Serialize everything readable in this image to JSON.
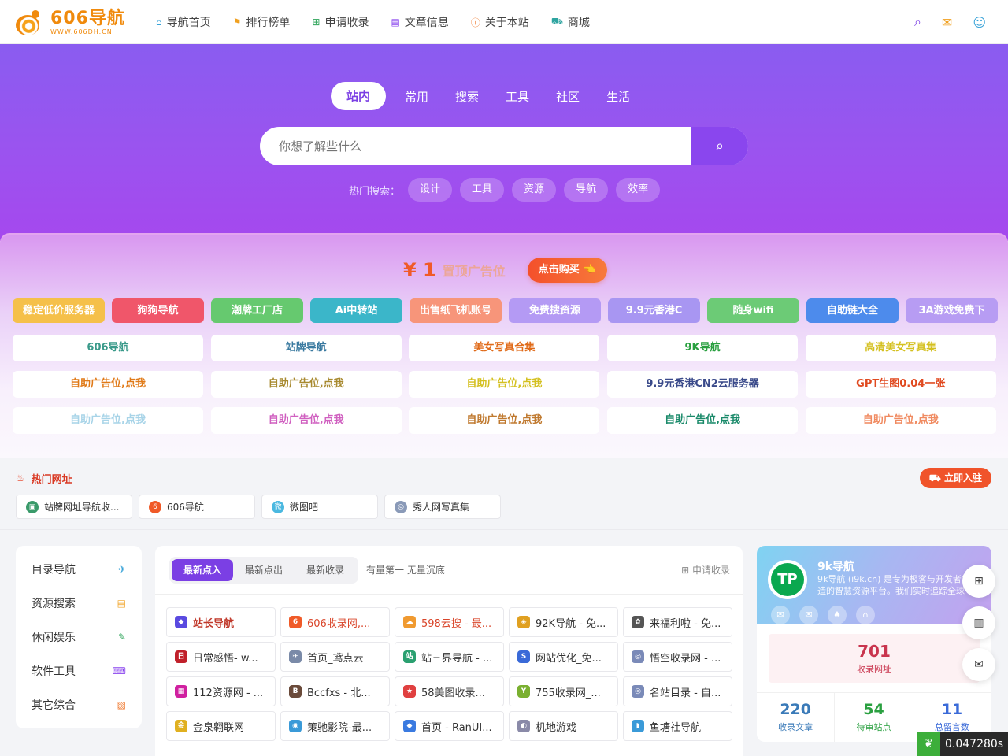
{
  "logo": {
    "main": "606导航",
    "sub": "WWW.606DH.CN"
  },
  "nav": [
    {
      "icon": "⌂",
      "label": "导航首页",
      "color": "#3aa3d8"
    },
    {
      "icon": "⚑",
      "label": "排行榜单",
      "color": "#f0a020"
    },
    {
      "icon": "⊞",
      "label": "申请收录",
      "color": "#2ea45a"
    },
    {
      "icon": "▤",
      "label": "文章信息",
      "color": "#8a46ee"
    },
    {
      "icon": "ⓘ",
      "label": "关于本站",
      "color": "#f07a30"
    },
    {
      "icon": "⛟",
      "label": "商城",
      "color": "#2ea4a0"
    }
  ],
  "nav_right": {
    "search": "⌕",
    "chat": "✉",
    "user": "☺"
  },
  "hero": {
    "tabs": [
      "站内",
      "常用",
      "搜索",
      "工具",
      "社区",
      "生活"
    ],
    "search_placeholder": "你想了解些什么",
    "search_icon": "⌕",
    "hot_label": "热门搜索：",
    "hot_tags": [
      "设计",
      "工具",
      "资源",
      "导航",
      "效率"
    ]
  },
  "ad": {
    "price": "¥ 1",
    "title": "置顶广告位",
    "buy": "点击购买 👈",
    "colored": [
      {
        "label": "稳定低价服务器",
        "bg": "#f5c04a"
      },
      {
        "label": "狗狗导航",
        "bg": "#f0566a"
      },
      {
        "label": "潮牌工厂店",
        "bg": "#66c96f"
      },
      {
        "label": "Ai中转站",
        "bg": "#3bb6c9"
      },
      {
        "label": "出售纸飞机账号",
        "bg": "#f7957a"
      },
      {
        "label": "免费搜资源",
        "bg": "#b49af4"
      },
      {
        "label": "9.9元香港C",
        "bg": "#a896f2"
      },
      {
        "label": "随身wifi",
        "bg": "#6ccb76"
      },
      {
        "label": "自助链大全",
        "bg": "#4d8bec"
      },
      {
        "label": "3A游戏免费下",
        "bg": "#b79cf3"
      }
    ],
    "white": [
      {
        "label": "606导航",
        "color": "#3a9a8a"
      },
      {
        "label": "站牌导航",
        "color": "#3a7aa0"
      },
      {
        "label": "美女写真合集",
        "color": "#e06a18"
      },
      {
        "label": "9K导航",
        "color": "#2aa040"
      },
      {
        "label": "高清美女写真集",
        "color": "#d4c020"
      },
      {
        "label": "自助广告位,点我",
        "color": "#e07a18"
      },
      {
        "label": "自助广告位,点我",
        "color": "#a88a30"
      },
      {
        "label": "自助广告位,点我",
        "color": "#d4c020"
      },
      {
        "label": "9.9元香港CN2云服务器",
        "color": "#3a4a8a"
      },
      {
        "label": "GPT生图0.04一张",
        "color": "#e04a20"
      },
      {
        "label": "自助广告位,点我",
        "color": "#a8d4e8"
      },
      {
        "label": "自助广告位,点我",
        "color": "#d060c0"
      },
      {
        "label": "自助广告位,点我",
        "color": "#c07a30"
      },
      {
        "label": "自助广告位,点我",
        "color": "#1a8a6a"
      },
      {
        "label": "自助广告位,点我",
        "color": "#f08a60"
      }
    ]
  },
  "hot_sites": {
    "title": "热门网址",
    "join": "立即入驻",
    "items": [
      {
        "label": "站牌网址导航收...",
        "fav": "▣",
        "bg": "#3a9a6a"
      },
      {
        "label": "606导航",
        "fav": "6",
        "bg": "#f05a28"
      },
      {
        "label": "微图吧",
        "fav": "微",
        "bg": "#4ab8e0"
      },
      {
        "label": "秀人网写真集",
        "fav": "◎",
        "bg": "#8a9ab8"
      }
    ]
  },
  "left_menu": [
    {
      "label": "目录导航",
      "icon": "✈",
      "color": "#3aa3d8"
    },
    {
      "label": "资源搜索",
      "icon": "▤",
      "color": "#f0a020"
    },
    {
      "label": "休闲娱乐",
      "icon": "✎",
      "color": "#2ea45a"
    },
    {
      "label": "软件工具",
      "icon": "⌨",
      "color": "#8a46ee"
    },
    {
      "label": "其它综合",
      "icon": "▧",
      "color": "#f07a30"
    }
  ],
  "main": {
    "tabs": [
      "最新点入",
      "最新点出",
      "最新收录"
    ],
    "slogan": "有量第一 无量沉底",
    "apply": "⊞ 申请收录",
    "sites": [
      {
        "label": "站长导航",
        "fav": "◆",
        "bg": "#5a4ae0",
        "color": "#c0392b",
        "bold": true
      },
      {
        "label": "606收录网,...",
        "fav": "6",
        "bg": "#f05a28",
        "color": "#d9452a"
      },
      {
        "label": "598云搜 - 最...",
        "fav": "☁",
        "bg": "#f09a30",
        "color": "#d9452a"
      },
      {
        "label": "92K导航 - 免...",
        "fav": "◈",
        "bg": "#e0a020",
        "color": "#333"
      },
      {
        "label": "来福利啦 - 免...",
        "fav": "✿",
        "bg": "#555",
        "color": "#333"
      },
      {
        "label": "日常感悟- w...",
        "fav": "日",
        "bg": "#c0202a",
        "color": "#333"
      },
      {
        "label": "首页_鸢点云",
        "fav": "✈",
        "bg": "#7a8aa8",
        "color": "#333"
      },
      {
        "label": "站三界导航 - ...",
        "fav": "站",
        "bg": "#2aa070",
        "color": "#333"
      },
      {
        "label": "网站优化_免...",
        "fav": "S",
        "bg": "#3a6ad8",
        "color": "#333"
      },
      {
        "label": "悟空收录网 - ...",
        "fav": "◎",
        "bg": "#7a8ab8",
        "color": "#333"
      },
      {
        "label": "112资源网 - ...",
        "fav": "▦",
        "bg": "#d020a0",
        "color": "#333"
      },
      {
        "label": "Bccfxs - 北...",
        "fav": "B",
        "bg": "#6a4a3a",
        "color": "#333"
      },
      {
        "label": "58美图收录...",
        "fav": "★",
        "bg": "#e04040",
        "color": "#333"
      },
      {
        "label": "755收录网_...",
        "fav": "Y",
        "bg": "#7ab030",
        "color": "#333"
      },
      {
        "label": "名站目录 - 自...",
        "fav": "◎",
        "bg": "#7a8ab8",
        "color": "#333"
      },
      {
        "label": "金泉翱联网",
        "fav": "金",
        "bg": "#e0b020",
        "color": "#333"
      },
      {
        "label": "策驰影院-最...",
        "fav": "◉",
        "bg": "#3a9ad8",
        "color": "#333"
      },
      {
        "label": "首页 - RanUI...",
        "fav": "◆",
        "bg": "#3a7ae0",
        "color": "#333"
      },
      {
        "label": "机地游戏",
        "fav": "◐",
        "bg": "#8a8aa8",
        "color": "#333"
      },
      {
        "label": "鱼塘社导航",
        "fav": "◗",
        "bg": "#3a9ad8",
        "color": "#333"
      }
    ]
  },
  "profile": {
    "name": "9k导航",
    "avatar": "TP",
    "desc": "9k导航 (i9k.cn) 是专为极客与开发者打造的智慧资源平台。我们实时追踪全球",
    "socials": [
      "✉",
      "✉",
      "♠",
      "⌂"
    ],
    "big_value": "701",
    "big_label": "收录网址",
    "stats": [
      {
        "value": "220",
        "label": "收录文章",
        "color": "#3a7ab8"
      },
      {
        "value": "54",
        "label": "待审站点",
        "color": "#2aa040"
      },
      {
        "value": "11",
        "label": "总留言数",
        "color": "#3a6ad8"
      }
    ]
  },
  "floaters": [
    "⊞",
    "▥",
    "✉"
  ],
  "timer": "0.047280s"
}
